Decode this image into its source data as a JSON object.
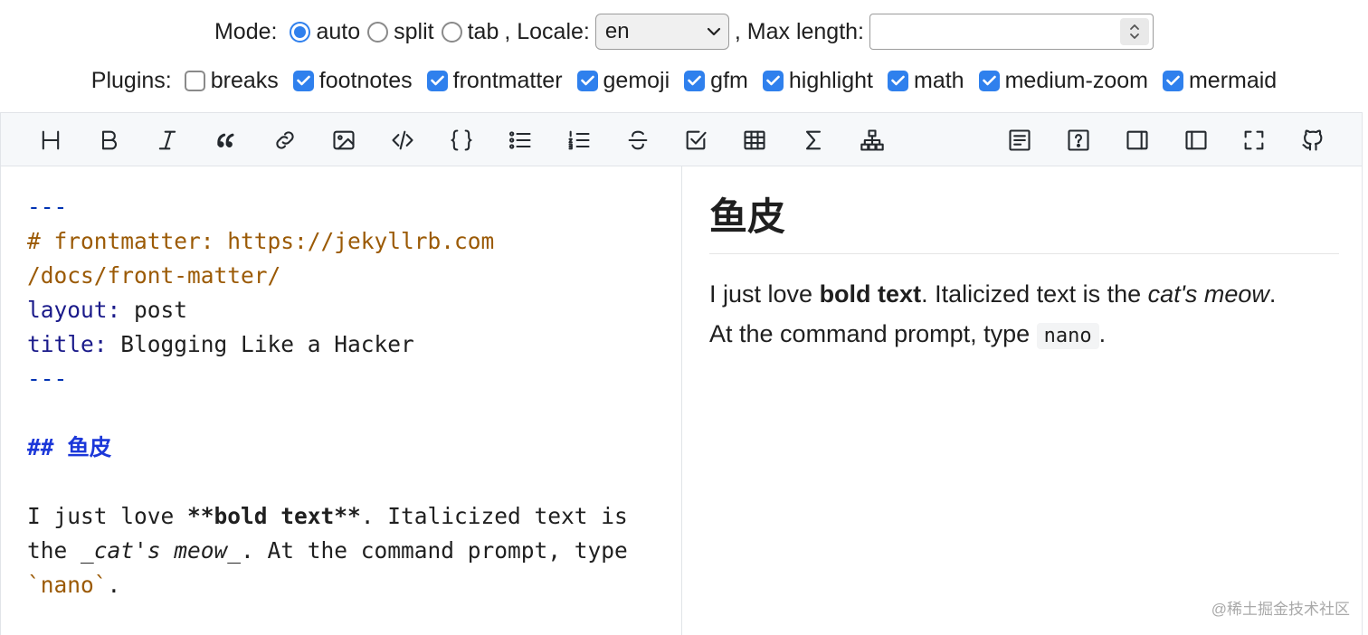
{
  "options": {
    "mode_label": "Mode:",
    "modes": [
      {
        "label": "auto",
        "checked": true
      },
      {
        "label": "split",
        "checked": false
      },
      {
        "label": "tab",
        "checked": false
      }
    ],
    "locale_label": ", Locale:",
    "locale_value": "en",
    "maxlength_label": ", Max length:",
    "maxlength_value": "",
    "plugins_label": "Plugins:",
    "plugins": [
      {
        "label": "breaks",
        "checked": false
      },
      {
        "label": "footnotes",
        "checked": true
      },
      {
        "label": "frontmatter",
        "checked": true
      },
      {
        "label": "gemoji",
        "checked": true
      },
      {
        "label": "gfm",
        "checked": true
      },
      {
        "label": "highlight",
        "checked": true
      },
      {
        "label": "math",
        "checked": true
      },
      {
        "label": "medium-zoom",
        "checked": true
      },
      {
        "label": "mermaid",
        "checked": true
      }
    ],
    "accent_color": "#2f80ed"
  },
  "toolbar": {
    "left_icons": [
      "heading-icon",
      "bold-icon",
      "italic-icon",
      "quote-icon",
      "link-icon",
      "image-icon",
      "code-icon",
      "code-block-icon",
      "unordered-list-icon",
      "ordered-list-icon",
      "strikethrough-icon",
      "task-list-icon",
      "table-icon",
      "math-icon",
      "mermaid-diagram-icon"
    ],
    "right_icons": [
      "table-of-contents-icon",
      "help-icon",
      "toggle-preview-icon",
      "toggle-source-icon",
      "fullscreen-icon",
      "github-icon"
    ]
  },
  "source": {
    "fm_open": "---",
    "comment_1": "# frontmatter: https://jekyllrb.com",
    "comment_2": "/docs/front-matter/",
    "layout_key": "layout",
    "layout_sep": ": ",
    "layout_val": "post",
    "title_key": "title",
    "title_sep": ": ",
    "title_val": "Blogging Like a Hacker",
    "fm_close": "---",
    "heading": "## 鱼皮",
    "p1_a": "I just love ",
    "p1_bold": "**bold text**",
    "p1_b": ". Italicized text is",
    "p2_a": "the ",
    "p2_it": "_cat's meow_",
    "p2_b": ". At the command prompt, type",
    "p3_code": "`nano`",
    "p3_end": "."
  },
  "preview": {
    "heading": "鱼皮",
    "t1": "I just love ",
    "bold": "bold text",
    "t2": ". Italicized text is the ",
    "italic": "cat's meow",
    "t3": ".",
    "t4": "At the command prompt, type ",
    "code": "nano",
    "t5": "."
  },
  "watermark": "@稀土掘金技术社区"
}
